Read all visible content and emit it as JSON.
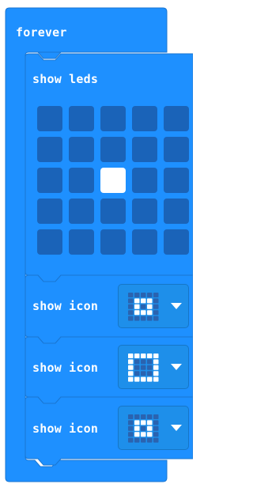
{
  "colors": {
    "block_fill": "#1e90ff",
    "block_stroke": "#1976d2",
    "led_off": "#1a63b8",
    "led_on": "#ffffff",
    "icon_off": "#2a63b0",
    "icon_on": "#ffffff"
  },
  "forever_block": {
    "label": "forever"
  },
  "show_leds_block": {
    "label": "show leds",
    "leds": [
      [
        0,
        0,
        0,
        0,
        0
      ],
      [
        0,
        0,
        0,
        0,
        0
      ],
      [
        0,
        0,
        1,
        0,
        0
      ],
      [
        0,
        0,
        0,
        0,
        0
      ],
      [
        0,
        0,
        0,
        0,
        0
      ]
    ]
  },
  "show_icon_blocks": [
    {
      "label": "show icon",
      "icon_pattern": [
        [
          0,
          0,
          0,
          0,
          0
        ],
        [
          0,
          1,
          1,
          1,
          0
        ],
        [
          0,
          1,
          0,
          1,
          0
        ],
        [
          0,
          1,
          1,
          1,
          0
        ],
        [
          0,
          0,
          0,
          0,
          0
        ]
      ],
      "dropdown_icon": "chevron-down-icon"
    },
    {
      "label": "show icon",
      "icon_pattern": [
        [
          1,
          1,
          1,
          1,
          1
        ],
        [
          1,
          0,
          0,
          0,
          1
        ],
        [
          1,
          0,
          0,
          0,
          1
        ],
        [
          1,
          0,
          0,
          0,
          1
        ],
        [
          1,
          1,
          1,
          1,
          1
        ]
      ],
      "dropdown_icon": "chevron-down-icon"
    },
    {
      "label": "show icon",
      "icon_pattern": [
        [
          0,
          0,
          0,
          0,
          0
        ],
        [
          0,
          1,
          1,
          1,
          0
        ],
        [
          0,
          1,
          0,
          1,
          0
        ],
        [
          0,
          1,
          1,
          1,
          0
        ],
        [
          0,
          0,
          0,
          0,
          0
        ]
      ],
      "dropdown_icon": "chevron-down-icon"
    }
  ]
}
